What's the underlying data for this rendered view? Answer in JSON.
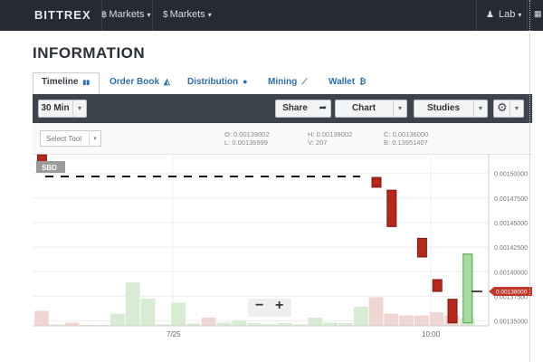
{
  "topbar": {
    "logo": "BITTREX",
    "nav": [
      {
        "icon": "bitcoin-icon",
        "glyph": "฿",
        "label": "Markets"
      },
      {
        "icon": "dollar-icon",
        "glyph": "$",
        "label": "Markets"
      }
    ],
    "user": {
      "icon": "user-icon",
      "label": "Lab"
    },
    "calendar_icon": "calendar-icon"
  },
  "page": {
    "title": "INFORMATION"
  },
  "tabs": [
    {
      "label": "Timeline",
      "icon": "bar-chart-icon",
      "glyph": "▮▮",
      "active": true
    },
    {
      "label": "Order Book",
      "icon": "area-chart-icon",
      "glyph": "◭",
      "active": false
    },
    {
      "label": "Distribution",
      "icon": "users-icon",
      "glyph": "●",
      "active": false
    },
    {
      "label": "Mining",
      "icon": "line-chart-icon",
      "glyph": "⟋",
      "active": false
    },
    {
      "label": "Wallet",
      "icon": "bitcoin-icon",
      "glyph": "₿",
      "active": false
    }
  ],
  "toolbar": {
    "interval": "30 Min",
    "share": "Share",
    "chart": "Chart",
    "studies": "Studies",
    "settings_icon": "gear-icon"
  },
  "subbar": {
    "select_tool": "Select Tool",
    "ohlc": [
      {
        "k": "O:",
        "v": "0.00139002"
      },
      {
        "k": "H:",
        "v": "0.00139002"
      },
      {
        "k": "C:",
        "v": "0.00136000"
      },
      {
        "k": "L:",
        "v": "0.00136999"
      },
      {
        "k": "V:",
        "v": "207"
      },
      {
        "k": "B:",
        "v": "0.13951407"
      }
    ]
  },
  "chart_data": {
    "type": "candlestick",
    "y_axis": {
      "min": 0.001345,
      "max": 0.00152,
      "tick_labels": [
        "0.00150000",
        "0.00147500",
        "0.00145000",
        "0.00142500",
        "0.00140000",
        "0.00137500",
        "0.00135000"
      ],
      "tick_values": [
        0.0015,
        0.001475,
        0.00145,
        0.001425,
        0.0014,
        0.001375,
        0.00135
      ]
    },
    "x_axis": {
      "labels": [
        "7/25",
        "10:00"
      ]
    },
    "current_price_label": "0.00138000",
    "current_price": 0.00138,
    "badge": "SBD",
    "dashed_level": 0.001497,
    "candles": [
      {
        "i": 0,
        "o": 0.001503,
        "c": 0.001519,
        "dir": "down"
      },
      {
        "i": 22,
        "o": 0.001496,
        "c": 0.001486,
        "dir": "down"
      },
      {
        "i": 23,
        "o": 0.001483,
        "c": 0.001446,
        "dir": "down"
      },
      {
        "i": 25,
        "o": 0.001434,
        "c": 0.001415,
        "dir": "down"
      },
      {
        "i": 26,
        "o": 0.001392,
        "c": 0.00138,
        "dir": "down"
      },
      {
        "i": 27,
        "o": 0.001372,
        "c": 0.001348,
        "dir": "down"
      },
      {
        "i": 28,
        "o": 0.001418,
        "c": 0.001348,
        "dir": "up"
      }
    ],
    "volume": [
      {
        "i": 0,
        "v": 0.55,
        "dir": "down"
      },
      {
        "i": 1,
        "v": 0.05,
        "dir": "up"
      },
      {
        "i": 2,
        "v": 0.12,
        "dir": "down"
      },
      {
        "i": 3,
        "v": 0.03,
        "dir": "up"
      },
      {
        "i": 4,
        "v": 0.03,
        "dir": "up"
      },
      {
        "i": 5,
        "v": 0.45,
        "dir": "up"
      },
      {
        "i": 6,
        "v": 1.6,
        "dir": "up"
      },
      {
        "i": 7,
        "v": 1.0,
        "dir": "up"
      },
      {
        "i": 8,
        "v": 0.05,
        "dir": "up"
      },
      {
        "i": 9,
        "v": 0.85,
        "dir": "up"
      },
      {
        "i": 10,
        "v": 0.08,
        "dir": "up"
      },
      {
        "i": 11,
        "v": 0.3,
        "dir": "down"
      },
      {
        "i": 12,
        "v": 0.12,
        "dir": "up"
      },
      {
        "i": 13,
        "v": 0.2,
        "dir": "up"
      },
      {
        "i": 14,
        "v": 0.1,
        "dir": "up"
      },
      {
        "i": 15,
        "v": 0.06,
        "dir": "up"
      },
      {
        "i": 16,
        "v": 0.1,
        "dir": "up"
      },
      {
        "i": 17,
        "v": 0.05,
        "dir": "up"
      },
      {
        "i": 18,
        "v": 0.3,
        "dir": "up"
      },
      {
        "i": 19,
        "v": 0.12,
        "dir": "up"
      },
      {
        "i": 20,
        "v": 0.1,
        "dir": "up"
      },
      {
        "i": 21,
        "v": 0.7,
        "dir": "up"
      },
      {
        "i": 22,
        "v": 1.05,
        "dir": "down"
      },
      {
        "i": 23,
        "v": 0.45,
        "dir": "down"
      },
      {
        "i": 24,
        "v": 0.38,
        "dir": "down"
      },
      {
        "i": 25,
        "v": 0.38,
        "dir": "down"
      },
      {
        "i": 26,
        "v": 0.5,
        "dir": "down"
      },
      {
        "i": 27,
        "v": 0.38,
        "dir": "down"
      },
      {
        "i": 28,
        "v": 0.3,
        "dir": "up"
      }
    ]
  },
  "colors": {
    "up": "#4aa24a",
    "down": "#b5281c",
    "vol_up": "#d7ecd2",
    "vol_down": "#f0d6d2",
    "price_tag": "#c0392b"
  },
  "zoom": {
    "minus": "−",
    "plus": "+"
  }
}
